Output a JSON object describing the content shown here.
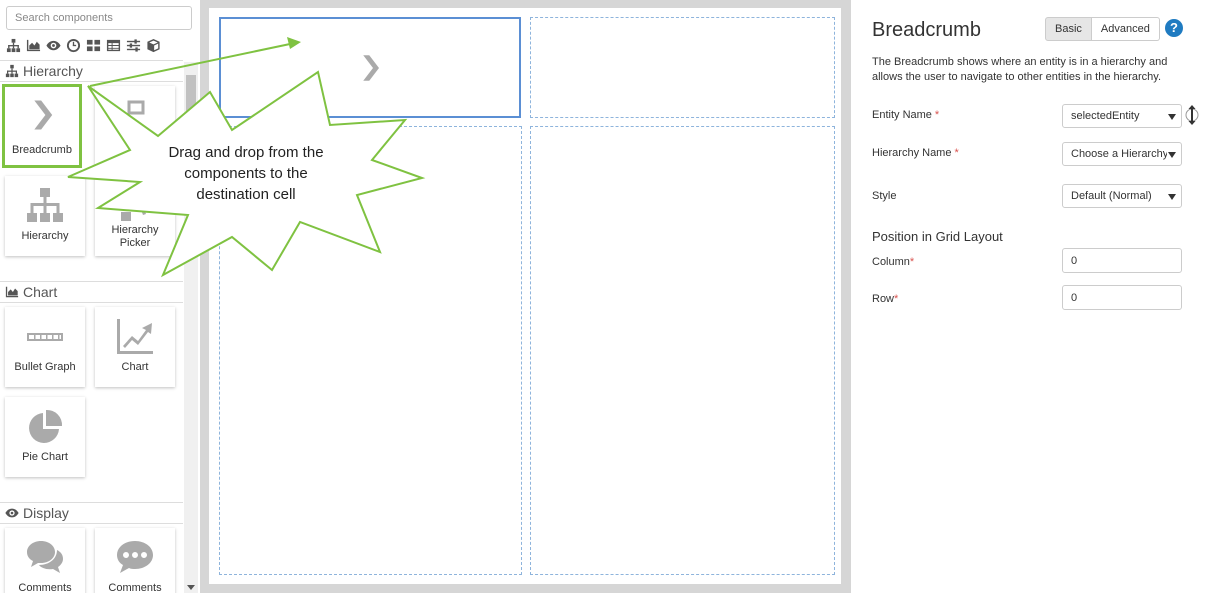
{
  "palette": {
    "search_placeholder": "Search components",
    "filter_icons": [
      "hierarchy-icon",
      "chart-area-icon",
      "eye-icon",
      "clock-icon",
      "grid-tiles-icon",
      "table-icon",
      "sliders-icon",
      "cube-icon"
    ],
    "sections": [
      {
        "title": "Hierarchy",
        "icon": "hierarchy-icon",
        "items": [
          {
            "label": "Breadcrumb",
            "icon": "chevron-right-icon",
            "selected": true
          },
          {
            "label": "",
            "icon": "hierarchy-picker-icon"
          },
          {
            "label": "Hierarchy",
            "icon": "hierarchy-icon"
          },
          {
            "label": "Hierarchy Picker",
            "icon": "hierarchy-picker-icon"
          }
        ]
      },
      {
        "title": "Chart",
        "icon": "chart-area-icon",
        "items": [
          {
            "label": "Bullet Graph",
            "icon": "bullet-graph-icon"
          },
          {
            "label": "Chart",
            "icon": "line-chart-icon"
          },
          {
            "label": "Pie Chart",
            "icon": "pie-chart-icon"
          }
        ]
      },
      {
        "title": "Display",
        "icon": "eye-icon",
        "items": [
          {
            "label": "Comments",
            "icon": "comments-icon"
          },
          {
            "label": "Comments",
            "icon": "comment-dots-icon"
          }
        ]
      }
    ]
  },
  "callout": {
    "lines": [
      "Drag and drop from the",
      "components to the",
      "destination cell"
    ],
    "stroke_color": "#7fc241"
  },
  "properties": {
    "title": "Breadcrumb",
    "modes": {
      "basic": "Basic",
      "advanced": "Advanced",
      "active": "basic"
    },
    "help": "?",
    "description": "The Breadcrumb shows where an entity is in a hierarchy and allows the user to navigate to other entities in the hierarchy.",
    "fields": {
      "entity_name": {
        "label": "Entity Name",
        "required": "*",
        "value": "selectedEntity"
      },
      "hierarchy_name": {
        "label": "Hierarchy Name",
        "required": "*",
        "value": "Choose a Hierarchy"
      },
      "style": {
        "label": "Style",
        "value": "Default (Normal)"
      }
    },
    "position_heading": "Position in Grid Layout",
    "column": {
      "label": "Column",
      "required": "*",
      "value": "0"
    },
    "row": {
      "label": "Row",
      "required": "*",
      "value": "0"
    }
  },
  "colors": {
    "accent_green": "#7fc241",
    "cell_border": "#8eb4dc",
    "selected_cell": "#5b8fd4",
    "help_blue": "#1f7bc1",
    "required_red": "#d9534f"
  }
}
